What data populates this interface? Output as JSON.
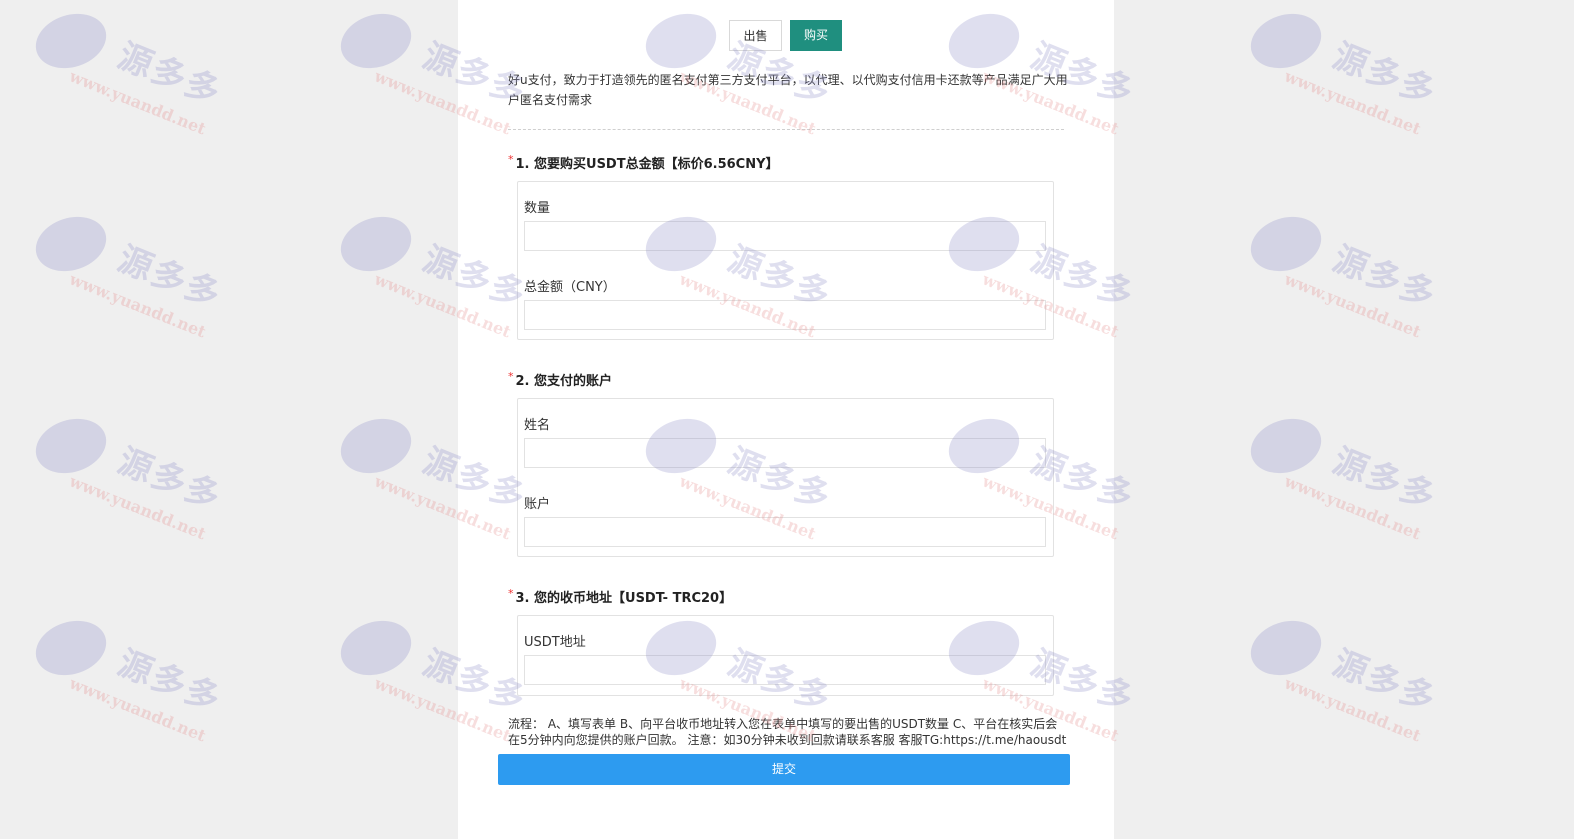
{
  "toggle": {
    "sell_label": "出售",
    "buy_label": "购买"
  },
  "intro": "好u支付，致力于打造领先的匿名支付第三方支付平台，以代理、以代购支付信用卡还款等产品满足广大用户匿名支付需求",
  "sections": [
    {
      "required": "*",
      "title": "1. 您要购买USDT总金额【标价6.56CNY】"
    },
    {
      "required": "*",
      "title": "2. 您支付的账户"
    },
    {
      "required": "*",
      "title": "3. 您的收币地址【USDT- TRC20】"
    }
  ],
  "fields": {
    "quantity_label": "数量",
    "quantity_value": "",
    "total_label": "总金额（CNY）",
    "total_value": "",
    "name_label": "姓名",
    "name_value": "",
    "account_label": "账户",
    "account_value": "",
    "usdt_label": "USDT地址",
    "usdt_value": ""
  },
  "process_text": "流程： A、填写表单 B、向平台收币地址转入您在表单中填写的要出售的USDT数量 C、平台在核实后会在5分钟内向您提供的账户回款。 注意：如30分钟未收到回款请联系客服 客服TG:https://t.me/haousdt",
  "submit_label": "提交",
  "watermark": {
    "text_cn": "源多多",
    "text_url": "www.yuandd.net"
  },
  "colors": {
    "buy_button": "#1f8f7f",
    "submit_button": "#2d9bf0",
    "required_mark": "#e33333"
  }
}
